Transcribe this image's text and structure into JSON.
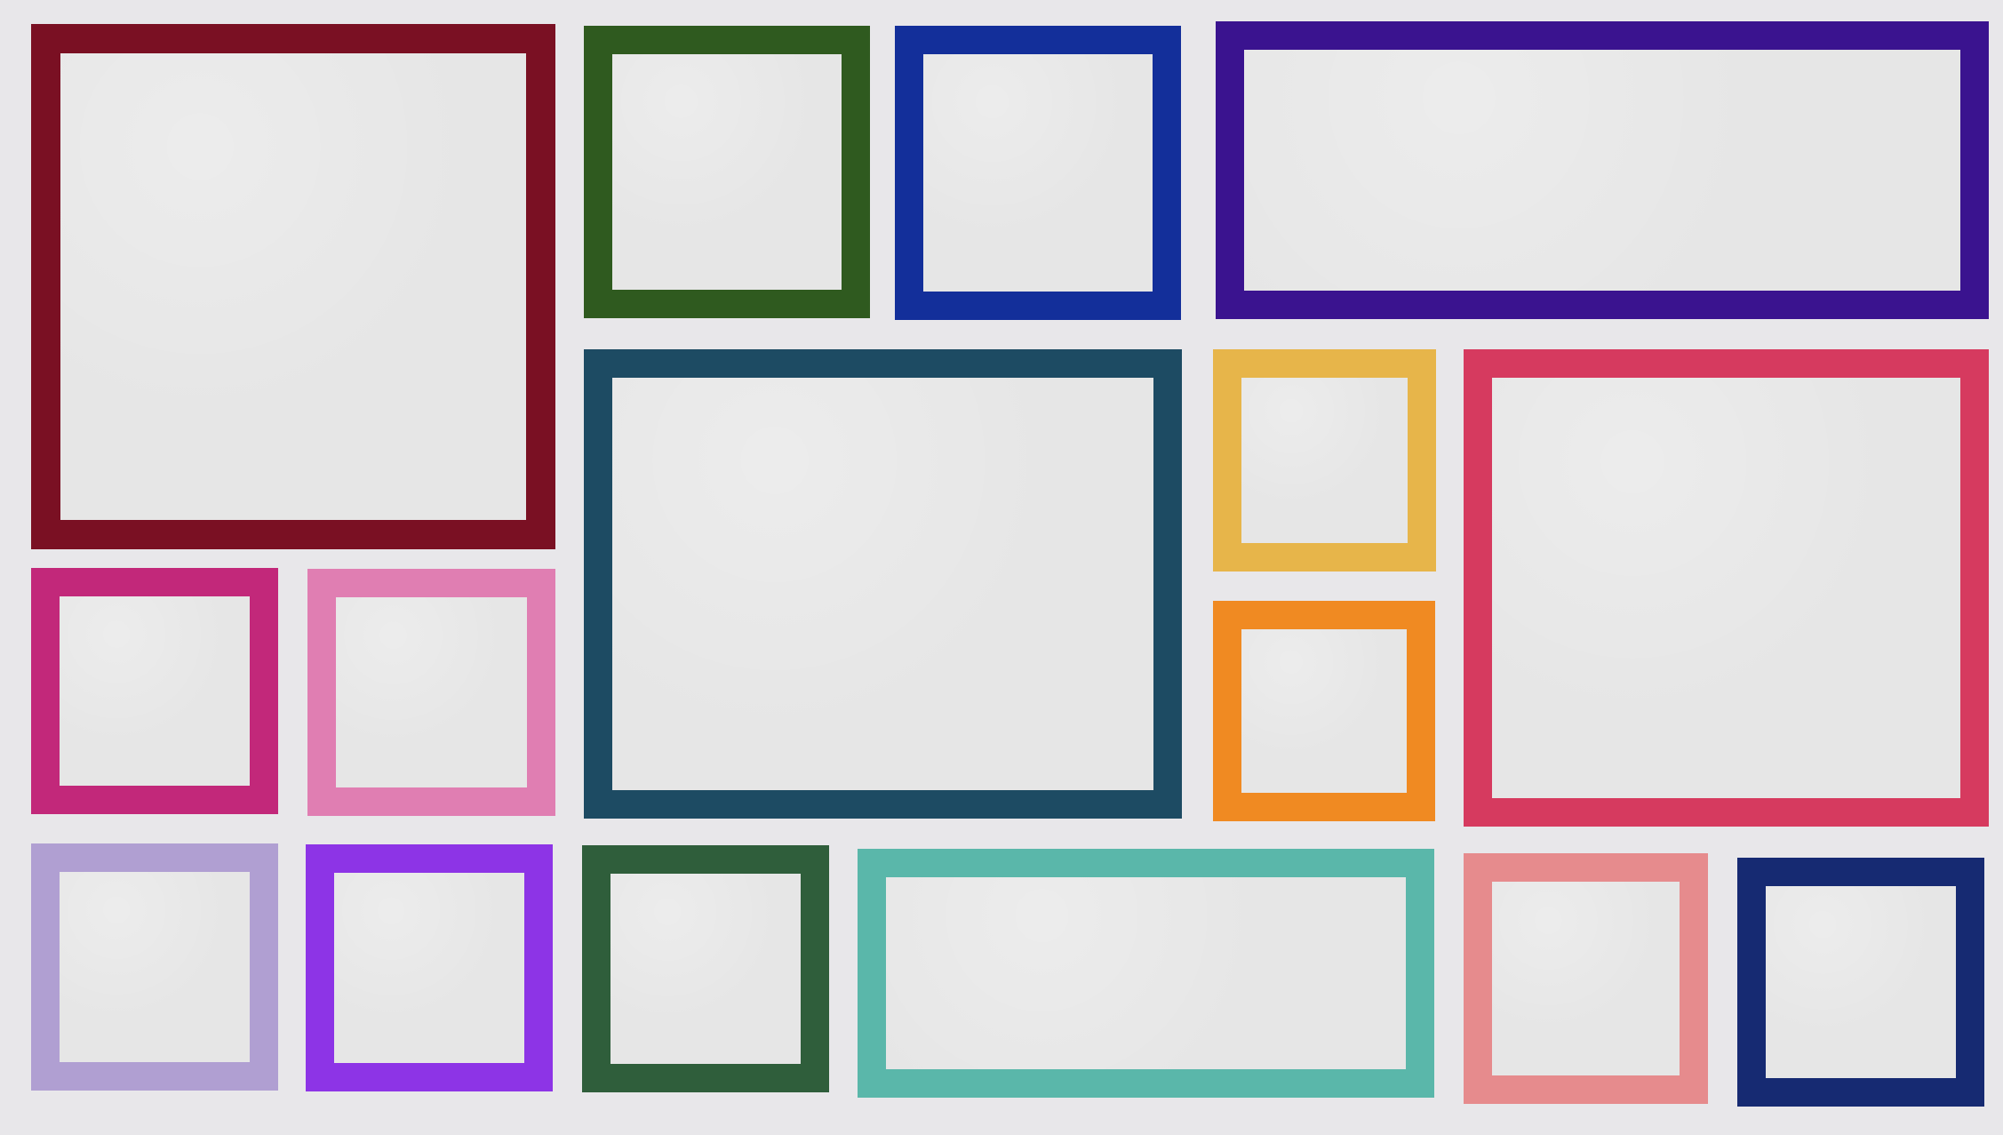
{
  "colors": {
    "background": "#e8e7ea",
    "tile_fill": "#e6e6e6"
  },
  "tiles": [
    {
      "name": "tile-dark-red",
      "color": "#7a1023"
    },
    {
      "name": "tile-green",
      "color": "#2f5a1f"
    },
    {
      "name": "tile-blue",
      "color": "#132f9a"
    },
    {
      "name": "tile-purple",
      "color": "#3a138f"
    },
    {
      "name": "tile-teal-navy",
      "color": "#1d4b63"
    },
    {
      "name": "tile-mustard",
      "color": "#e7b54a"
    },
    {
      "name": "tile-orange",
      "color": "#f08a22"
    },
    {
      "name": "tile-red-pink",
      "color": "#d63a5f"
    },
    {
      "name": "tile-magenta",
      "color": "#c2287a"
    },
    {
      "name": "tile-pink",
      "color": "#e07eb2"
    },
    {
      "name": "tile-lavender",
      "color": "#b09fd2"
    },
    {
      "name": "tile-violet",
      "color": "#8d34e6"
    },
    {
      "name": "tile-dark-green",
      "color": "#2f5e3b"
    },
    {
      "name": "tile-aqua",
      "color": "#5ab7aa"
    },
    {
      "name": "tile-salmon",
      "color": "#e68b8d"
    },
    {
      "name": "tile-navy",
      "color": "#162a72"
    }
  ]
}
